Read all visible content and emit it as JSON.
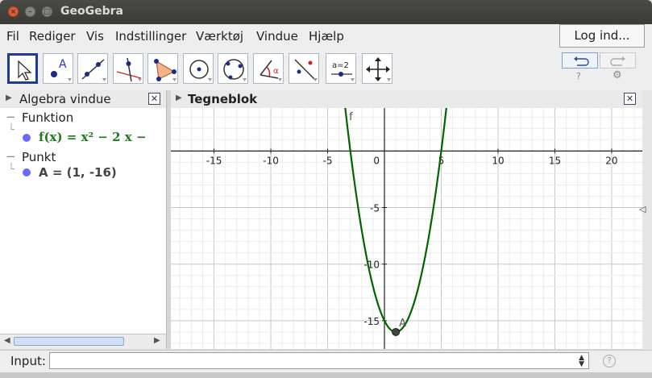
{
  "window": {
    "title": "GeoGebra"
  },
  "menu": {
    "items": [
      "Fil",
      "Rediger",
      "Vis",
      "Indstillinger",
      "Værktøj",
      "Vindue",
      "Hjælp"
    ],
    "login": "Log ind..."
  },
  "toolbar": {
    "tools": [
      "move-tool",
      "point-tool",
      "line-tool",
      "perpendicular-line-tool",
      "polygon-tool",
      "circle-center-point-tool",
      "circle-three-points-tool",
      "angle-tool",
      "reflect-tool",
      "slider-tool",
      "move-graphics-view-tool"
    ],
    "slider_label": "a=2",
    "point_label": "A",
    "angle_label": "α"
  },
  "algebra": {
    "title": "Algebra vindue",
    "groups": [
      {
        "label": "Funktion",
        "item": "f(x) = x² − 2 x −"
      },
      {
        "label": "Punkt",
        "item": "A = (1, -16)"
      }
    ],
    "function_color": "#1f7a1f",
    "point_color": "#555555"
  },
  "graphics": {
    "title": "Tegneblok",
    "function_label": "f",
    "point_label": "A",
    "curve_color": "#006400",
    "x_ticks": [
      "-15",
      "-10",
      "-5",
      "0",
      "5",
      "10",
      "15",
      "20"
    ],
    "y_ticks": [
      "-5",
      "-10",
      "-15"
    ]
  },
  "chart_data": {
    "type": "line",
    "title": "",
    "xlabel": "",
    "ylabel": "",
    "xlim": [
      -18.8,
      22.7
    ],
    "ylim": [
      -17.5,
      3.8
    ],
    "grid": true,
    "series": [
      {
        "name": "f",
        "function": "x^2 - 2x - 15",
        "x": [
          -4,
          -3,
          -2,
          -1,
          0,
          1,
          2,
          3,
          4,
          5,
          6
        ],
        "y": [
          9,
          0,
          -7,
          -12,
          -15,
          -16,
          -15,
          -12,
          -7,
          0,
          9
        ]
      }
    ],
    "points": [
      {
        "label": "A",
        "x": 1,
        "y": -16
      }
    ]
  },
  "inputbar": {
    "label": "Input:"
  }
}
